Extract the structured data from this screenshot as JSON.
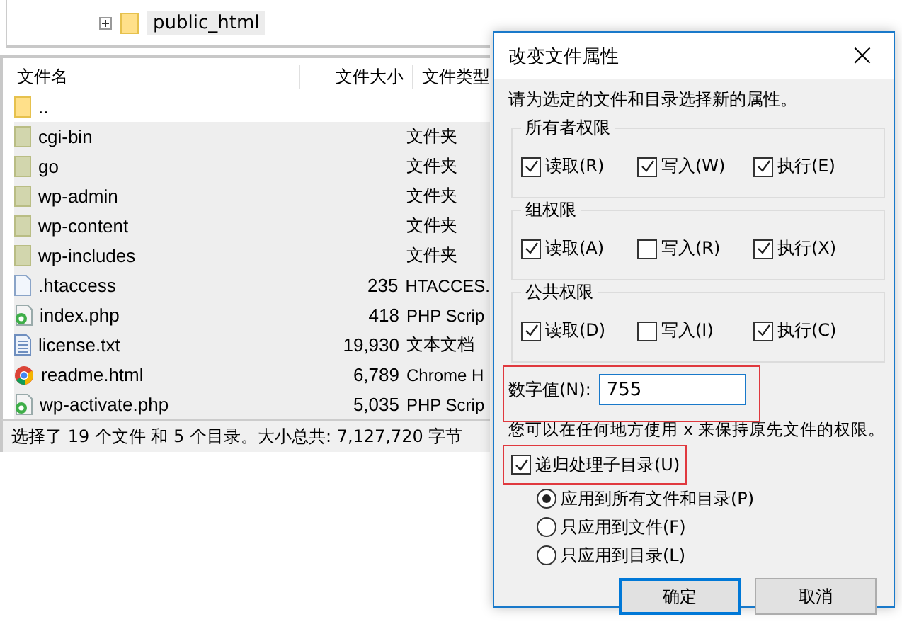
{
  "tree": [
    {
      "label": "public_html",
      "expanded": false,
      "selected": true
    }
  ],
  "file_list": {
    "columns": [
      "文件名",
      "文件大小",
      "文件类型"
    ],
    "rows": [
      {
        "name": "..",
        "size": "",
        "type": "",
        "kind": "parent",
        "selected": false
      },
      {
        "name": "cgi-bin",
        "size": "",
        "type": "文件夹",
        "kind": "folder",
        "selected": true
      },
      {
        "name": "go",
        "size": "",
        "type": "文件夹",
        "kind": "folder",
        "selected": true
      },
      {
        "name": "wp-admin",
        "size": "",
        "type": "文件夹",
        "kind": "folder",
        "selected": true
      },
      {
        "name": "wp-content",
        "size": "",
        "type": "文件夹",
        "kind": "folder",
        "selected": true
      },
      {
        "name": "wp-includes",
        "size": "",
        "type": "文件夹",
        "kind": "folder",
        "selected": true
      },
      {
        "name": ".htaccess",
        "size": "235",
        "type": "HTACCES.",
        "kind": "file",
        "selected": true
      },
      {
        "name": "index.php",
        "size": "418",
        "type": "PHP Scrip",
        "kind": "php",
        "selected": true
      },
      {
        "name": "license.txt",
        "size": "19,930",
        "type": "文本文档",
        "kind": "text",
        "selected": true
      },
      {
        "name": "readme.html",
        "size": "6,789",
        "type": "Chrome H",
        "kind": "browser",
        "selected": true
      },
      {
        "name": "wp-activate.php",
        "size": "5,035",
        "type": "PHP Scrip",
        "kind": "php",
        "selected": true
      }
    ]
  },
  "status_bar": "选择了 19 个文件 和 5 个目录。大小总共: 7,127,720 字节",
  "dialog": {
    "title": "改变文件属性",
    "close": "×",
    "description": "请为选定的文件和目录选择新的属性。",
    "groups": [
      {
        "title": "所有者权限",
        "options": [
          {
            "label": "读取(R)",
            "checked": true
          },
          {
            "label": "写入(W)",
            "checked": true
          },
          {
            "label": "执行(E)",
            "checked": true
          }
        ]
      },
      {
        "title": "组权限",
        "options": [
          {
            "label": "读取(A)",
            "checked": true
          },
          {
            "label": "写入(R)",
            "checked": false
          },
          {
            "label": "执行(X)",
            "checked": true
          }
        ]
      },
      {
        "title": "公共权限",
        "options": [
          {
            "label": "读取(D)",
            "checked": true
          },
          {
            "label": "写入(I)",
            "checked": false
          },
          {
            "label": "执行(C)",
            "checked": true
          }
        ]
      }
    ],
    "numeric": {
      "label": "数字值(N):",
      "value": "755",
      "highlighted": true
    },
    "hint": "您可以在任何地方使用 x 来保持原先文件的权限。",
    "recurse": {
      "label": "递归处理子目录(U)",
      "checked": true,
      "highlighted": true
    },
    "apply_options": [
      {
        "label": "应用到所有文件和目录(P)",
        "selected": true
      },
      {
        "label": "只应用到文件(F)",
        "selected": false
      },
      {
        "label": "只应用到目录(L)",
        "selected": false
      }
    ],
    "buttons": [
      {
        "label": "确定",
        "default": true
      },
      {
        "label": "取消",
        "default": false
      }
    ]
  }
}
